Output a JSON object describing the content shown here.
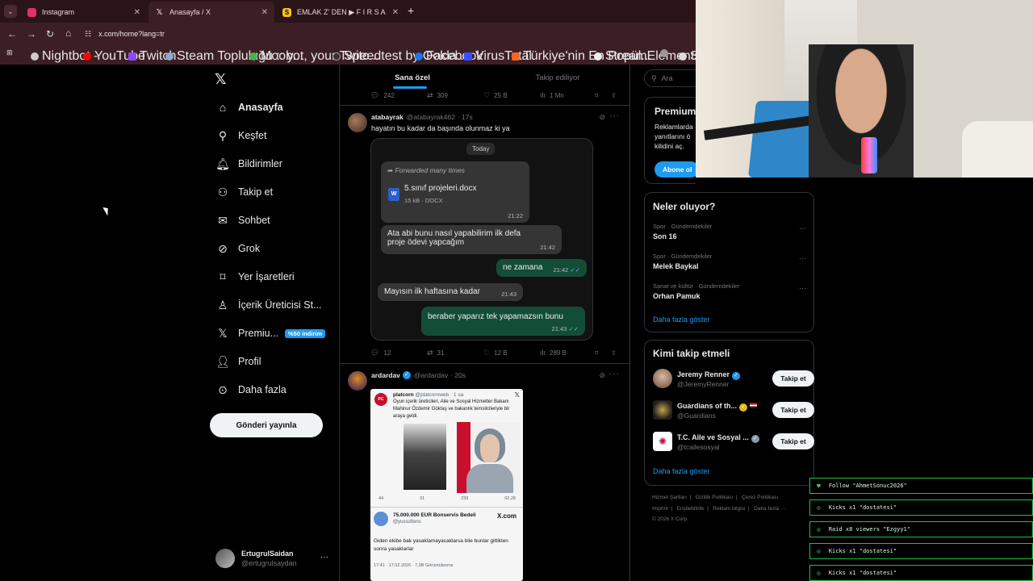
{
  "browser": {
    "tabs": [
      {
        "label": "Instagram",
        "icon": "instagram-icon",
        "color": "#e1306c"
      },
      {
        "label": "Anasayfa / X",
        "icon": "x-logo-icon",
        "color": "#ffffff"
      },
      {
        "label": "EMLAK Z' DEN ▶ F I R S A T I",
        "icon": "s-logo-icon",
        "color": "#f5c518"
      }
    ],
    "url": "x.com/home?lang=tr",
    "bookmarks": [
      {
        "label": "Nightbot -",
        "color": "#cccccc"
      },
      {
        "label": "YouTube",
        "color": "#ff0000"
      },
      {
        "label": "Twitch",
        "color": "#9146ff"
      },
      {
        "label": "Steam Topluluğu :: y...",
        "color": "#1b2838"
      },
      {
        "label": "Moobot, your Twitc...",
        "color": "#4caf50"
      },
      {
        "label": "Speedtest by Ookla...",
        "color": "#141526"
      },
      {
        "label": "Facebook",
        "color": "#1877f2"
      },
      {
        "label": "VirusTotal",
        "color": "#394eff"
      },
      {
        "label": "Türkiye'nin En Popül...",
        "color": "#f26522"
      },
      {
        "label": "StreamElements",
        "color": "#eeeeee"
      },
      {
        "label": "Su",
        "color": "#dddddd"
      }
    ]
  },
  "nav": {
    "items": [
      {
        "label": "Anasayfa",
        "icon": "home-icon"
      },
      {
        "label": "Keşfet",
        "icon": "search-icon"
      },
      {
        "label": "Bildirimler",
        "icon": "bell-icon"
      },
      {
        "label": "Takip et",
        "icon": "add-user-icon"
      },
      {
        "label": "Sohbet",
        "icon": "mail-icon"
      },
      {
        "label": "Grok",
        "icon": "grok-icon"
      },
      {
        "label": "Yer İşaretleri",
        "icon": "bookmark-icon"
      },
      {
        "label": "İçerik Üreticisi St...",
        "icon": "creator-icon"
      },
      {
        "label": "Premiu...",
        "icon": "x-logo-icon"
      },
      {
        "label": "Profil",
        "icon": "profile-icon"
      },
      {
        "label": "Daha fazla",
        "icon": "more-icon"
      }
    ],
    "premium_badge": "%50 indirim",
    "post_button": "Gönderi yayınla",
    "me": {
      "name": "ErtugrulSaidan",
      "handle": "@ertugrulsaydan"
    }
  },
  "feed": {
    "tabs": [
      "Sana özel",
      "Takip ediliyor"
    ],
    "prev_actions": {
      "replies": "242",
      "retweets": "309",
      "likes": "25 B",
      "views": "1 Mn"
    },
    "tweet1": {
      "name": "atabayrak",
      "handle": "@atabayrak462",
      "time": "· 17s",
      "text": "hayatın bu kadar da başında olunmaz ki ya",
      "chat": {
        "today": "Today",
        "forwarded": "Forwarded many times",
        "file_name": "5.sınıf projeleri.docx",
        "file_meta": "15 kB · DOCX",
        "file_time": "21:22",
        "messages": [
          {
            "text": "Ata abi bunu nasıl yapabilirim ilk defa proje ödevi yapcağım",
            "time": "21:42"
          },
          {
            "text": "ne zamana",
            "time": "21:42"
          },
          {
            "text": "Mayısın ilk haftasına kadar",
            "time": "21:43"
          },
          {
            "text": "beraber yaparız tek yapamazsın bunu",
            "time": "21:43"
          }
        ]
      },
      "actions": {
        "replies": "12",
        "retweets": "31",
        "likes": "12 B",
        "views": "289 B"
      }
    },
    "tweet2": {
      "name": "ardardav",
      "handle": "@ardardav",
      "time": "· 20s",
      "embed": {
        "name": "platcorn",
        "handle": "@platcornweb · 1 sa",
        "text": "Oyun içerik üreticileri, Aile ve Sosyal Hizmetler Bakanı Mahinur Özdemir Göktaş ve bakanlık temsilcileriyle bir araya geldi.",
        "stats": [
          "44",
          "31",
          "239",
          "92,28"
        ],
        "card_title": "75.000.000 EUR Bonservis Bedeli",
        "card_handle": "@yussuftens",
        "card_brand": "X.com",
        "body": "Giden ekibe bak yasaklamayacaklarsa bile bunlar gittikten sonra yasaklarlar",
        "footer": "17:41 · 17.02.2026 · 7,3B Görüntülenme"
      }
    }
  },
  "right": {
    "search_placeholder": "Ara",
    "premium": {
      "title": "Premium",
      "text1": "Reklamlarda",
      "text2": "yanıtlarını ö",
      "text3": "kilidini aç.",
      "button": "Abone ol"
    },
    "trends_title": "Neler oluyor?",
    "trends": [
      {
        "category": "Spor · Gündemdekiler",
        "title": "Son 16"
      },
      {
        "category": "Spor · Gündemdekiler",
        "title": "Melek Baykal"
      },
      {
        "category": "Sanat ve kültür · Gündemdekiler",
        "title": "Orhan Pamuk"
      }
    ],
    "trends_more": "Daha fazla göster",
    "who_title": "Kimi takip etmeli",
    "who": [
      {
        "name": "Jeremy Renner",
        "handle": "@JeremyRenner",
        "button": "Takip et"
      },
      {
        "name": "Guardians of th...",
        "handle": "@Guardians",
        "button": "Takip et"
      },
      {
        "name": "T.C. Aile ve Sosyal ...",
        "handle": "@tcailesosyal",
        "button": "Takip et"
      }
    ],
    "who_more": "Daha fazla göster",
    "footer_line1": [
      "Hizmet Şartları",
      "Gizlilik Politikası",
      "Çerez Politikası"
    ],
    "footer_line2": [
      "Imprint",
      "Erişilebilirlik",
      "Reklam bilgisi",
      "Daha fazla ···"
    ],
    "copyright": "© 2026 X Corp."
  },
  "alerts": [
    {
      "text": "Follow \"AhmetSonuc2026\"",
      "icon": "heart-icon"
    },
    {
      "text": "Kicks x1 \"dostatesi\"",
      "icon": "kick-icon"
    },
    {
      "text": "Raid x8 viewers \"Ezgyy1\"",
      "icon": "raid-icon"
    },
    {
      "text": "Kicks x1 \"dostatesi\"",
      "icon": "kick-icon"
    },
    {
      "text": "Kicks x1 \"dostatesi\"",
      "icon": "kick-icon"
    }
  ]
}
